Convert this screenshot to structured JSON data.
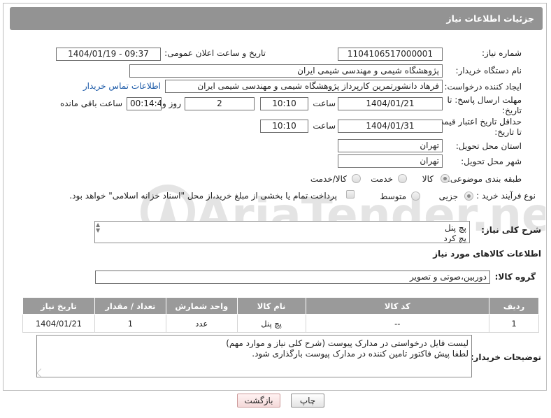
{
  "header": {
    "title": "جزئیات اطلاعات نیاز"
  },
  "fields": {
    "need_number": {
      "label": "شماره نیاز:",
      "value": "1104106517000001"
    },
    "announce": {
      "label": "تاریخ و ساعت اعلان عمومی:",
      "value": "1404/01/19 - 09:37"
    },
    "buyer": {
      "label": "نام دستگاه خریدار:",
      "value": "پژوهشگاه شیمی و مهندسی شیمی ایران"
    },
    "creator": {
      "label": "ایجاد کننده درخواست:",
      "value": "فرهاد دانشورتمرین کارپرداز پژوهشگاه شیمی و مهندسی شیمی ایران",
      "contact_link": "اطلاعات تماس خریدار"
    },
    "deadline": {
      "label": "مهلت ارسال پاسخ: تا تاریخ:",
      "date": "1404/01/21",
      "time_label": "ساعت",
      "time": "10:10",
      "days": "2",
      "days_label": "روز و",
      "remaining": "00:14:41",
      "remaining_label": "ساعت باقی مانده"
    },
    "price_validity": {
      "label": "حداقل تاریخ اعتبار قیمت: تا تاریخ:",
      "date": "1404/01/31",
      "time_label": "ساعت",
      "time": "10:10"
    },
    "province": {
      "label": "استان محل تحویل:",
      "value": "تهران"
    },
    "city": {
      "label": "شهر محل تحویل:",
      "value": "تهران"
    },
    "category": {
      "label": "طبقه بندی موضوعی:",
      "options": [
        "کالا",
        "خدمت",
        "کالا/خدمت"
      ],
      "selected": "کالا"
    },
    "process": {
      "label": "نوع فرآیند خرید :",
      "options": [
        "جزیی",
        "متوسط"
      ],
      "selected": "جزیی",
      "payment_note": "پرداخت تمام یا بخشی از مبلغ خرید،از محل \"اسناد خزانه اسلامی\" خواهد بود."
    }
  },
  "description": {
    "label": "شرح کلی نیاز:",
    "lines": [
      "پچ پنل",
      "پچ کرد"
    ]
  },
  "goods_section": {
    "title": "اطلاعات کالاهای مورد نیاز"
  },
  "goods_group": {
    "label": "گروه کالا:",
    "value": "دوربین،صوتی و تصویر"
  },
  "table": {
    "headers": [
      "ردیف",
      "کد کالا",
      "نام کالا",
      "واحد شمارش",
      "تعداد / مقدار",
      "تاریخ نیاز"
    ],
    "rows": [
      [
        "1",
        "--",
        "پچ پنل",
        "عدد",
        "1",
        "1404/01/21"
      ]
    ]
  },
  "buyer_notes": {
    "label": "توضیحات خریدار:",
    "lines": [
      "لیست فایل درخواستی در مدارک پیوست (شرح کلی نیاز و موارد مهم)",
      "لطفا پیش فاکتور تامین کننده در مدارک پیوست بارگذاری شود."
    ]
  },
  "buttons": {
    "print": "چاپ",
    "back": "بازگشت"
  },
  "watermark": {
    "text": "AriaTender.neT"
  },
  "colors": {
    "header_bg": "#939393",
    "table_header_bg": "#9a9a9a",
    "link": "#1c5aa8",
    "back_button": "#f4d9d9"
  }
}
